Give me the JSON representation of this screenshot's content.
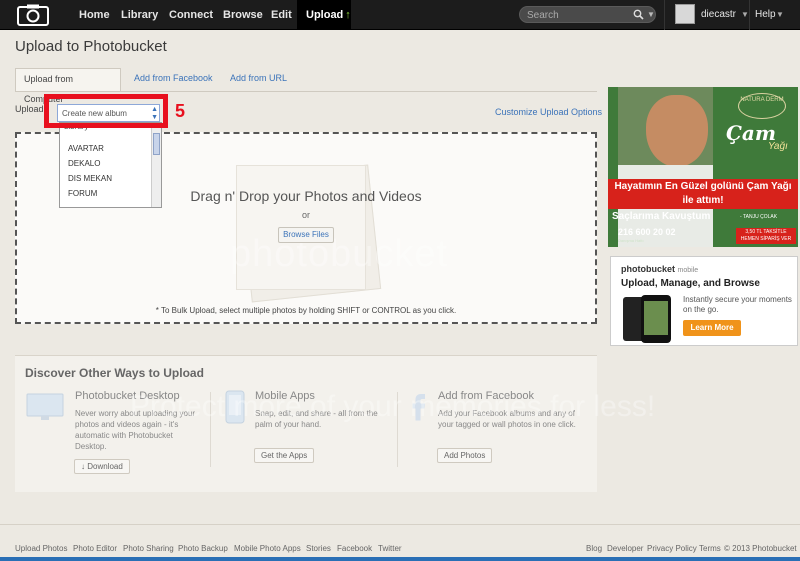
{
  "nav": {
    "home": "Home",
    "library": "Library",
    "connect": "Connect",
    "browse": "Browse",
    "edit": "Edit",
    "upload": "Upload",
    "search_placeholder": "Search",
    "username": "diecastr",
    "help": "Help"
  },
  "page": {
    "title": "Upload to Photobucket",
    "tabs": [
      {
        "label": "Upload from Computer"
      },
      {
        "label": "Add from Facebook"
      },
      {
        "label": "Add from URL"
      }
    ],
    "upload_label": "Upload",
    "customize": "Customize Upload Options"
  },
  "album_picker": {
    "selected": "Create new album",
    "partial_row": "Library",
    "options": [
      "AVARTAR",
      "DEKALO",
      "DIS MEKAN",
      "FORUM"
    ]
  },
  "annotation": {
    "step": "5",
    "color": "#e8101e"
  },
  "dropzone": {
    "headline": "Drag n' Drop your Photos and Videos",
    "or": "or",
    "browse": "Browse Files",
    "bulk_hint": "* To Bulk Upload, select multiple photos by holding SHIFT or CONTROL as you click."
  },
  "watermark": {
    "line1": "photobucket",
    "line2": "Protect more of your memories for less!"
  },
  "discover": {
    "title": "Discover Other Ways to Upload",
    "columns": [
      {
        "title": "Photobucket Desktop",
        "desc": "Never worry about uploading your photos and videos again - it's automatic with Photobucket Desktop.",
        "button": "Download"
      },
      {
        "title": "Mobile Apps",
        "desc": "Snap, edit, and share - all from the palm of your hand.",
        "button": "Get the Apps"
      },
      {
        "title": "Add from Facebook",
        "desc": "Add your Facebook albums and any of your tagged or wall photos in one click.",
        "button": "Add Photos"
      }
    ]
  },
  "ads": {
    "natura": {
      "brand": "NATURA DERM",
      "product_line1": "Çam",
      "product_line2": "Yağı",
      "headline": "Hayatımın En Güzel golünü Çam Yağı ile attım!",
      "sub": "Saçlarıma Kavuştum",
      "signature": "- TANJU ÇOLAK",
      "phone": "216 600 20 02",
      "phone_sub": "Danışma Hattı",
      "cta": "3,50 TL TAKSİTLE HEMEN SİPARİŞ VER"
    },
    "mobile": {
      "logo": "photobucket",
      "logo_suffix": "mobile",
      "title": "Upload, Manage, and Browse",
      "desc": "Instantly secure your moments on the go.",
      "button": "Learn More"
    }
  },
  "footer": {
    "left": [
      "Upload Photos",
      "Photo Editor",
      "Photo Sharing",
      "Photo Backup",
      "Mobile Photo Apps",
      "Stories",
      "Facebook",
      "Twitter"
    ],
    "right": [
      "Blog",
      "Developer",
      "Privacy Policy",
      "Terms",
      "© 2013 Photobucket"
    ]
  }
}
